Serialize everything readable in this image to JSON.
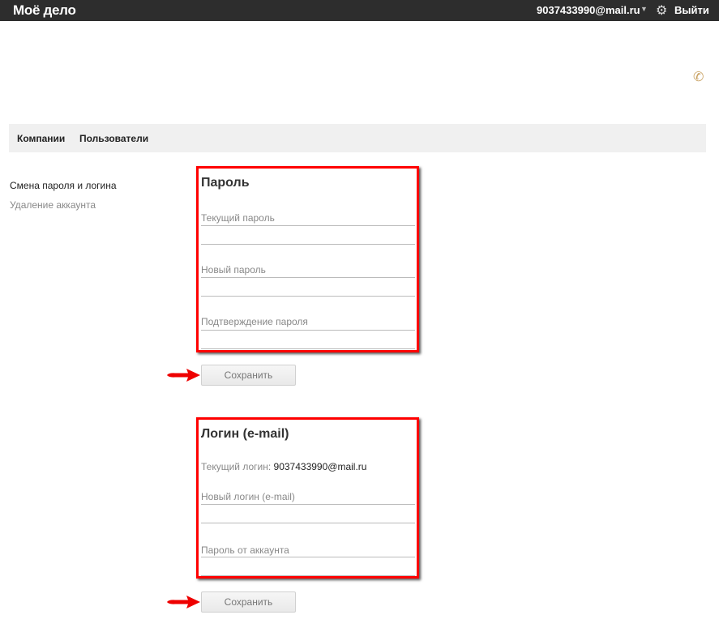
{
  "topbar": {
    "logo": "Моё дело",
    "user": "9037433990@mail.ru",
    "logout": "Выйти"
  },
  "nav": {
    "items": [
      "Компании",
      "Пользователи"
    ]
  },
  "sidebar": {
    "items": [
      "Смена пароля и логина",
      "Удаление аккаунта"
    ]
  },
  "password": {
    "title": "Пароль",
    "current_label": "Текущий пароль",
    "new_label": "Новый пароль",
    "confirm_label": "Подтверждение пароля",
    "save": "Сохранить"
  },
  "login": {
    "title": "Логин (e-mail)",
    "current_prefix": "Текущий логин:",
    "current_value": "9037433990@mail.ru",
    "new_label": "Новый логин (e-mail)",
    "password_label": "Пароль от аккаунта",
    "save": "Сохранить"
  }
}
